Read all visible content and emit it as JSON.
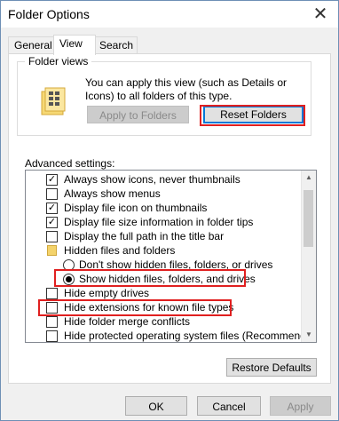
{
  "window": {
    "title": "Folder Options",
    "close_glyph": "✕"
  },
  "tabs": [
    {
      "label": "General",
      "active": false
    },
    {
      "label": "View",
      "active": true
    },
    {
      "label": "Search",
      "active": false
    }
  ],
  "folder_views": {
    "legend": "Folder views",
    "description": "You can apply this view (such as Details or Icons) to all folders of this type.",
    "apply_button": "Apply to Folders",
    "reset_button": "Reset Folders",
    "icon": "folder-icon"
  },
  "advanced": {
    "label": "Advanced settings:",
    "items": [
      {
        "label": "Always show icons, never thumbnails",
        "kind": "checkbox",
        "checked": true
      },
      {
        "label": "Always show menus",
        "kind": "checkbox",
        "checked": false
      },
      {
        "label": "Display file icon on thumbnails",
        "kind": "checkbox",
        "checked": true
      },
      {
        "label": "Display file size information in folder tips",
        "kind": "checkbox",
        "checked": true
      },
      {
        "label": "Display the full path in the title bar",
        "kind": "checkbox",
        "checked": false
      },
      {
        "label": "Hidden files and folders",
        "kind": "folder"
      },
      {
        "label": "Don't show hidden files, folders, or drives",
        "kind": "radio",
        "checked": false
      },
      {
        "label": "Show hidden files, folders, and drives",
        "kind": "radio",
        "checked": true
      },
      {
        "label": "Hide empty drives",
        "kind": "checkbox",
        "checked": false
      },
      {
        "label": "Hide extensions for known file types",
        "kind": "checkbox",
        "checked": false
      },
      {
        "label": "Hide folder merge conflicts",
        "kind": "checkbox",
        "checked": false
      },
      {
        "label": "Hide protected operating system files (Recommended)",
        "kind": "checkbox",
        "checked": false
      }
    ]
  },
  "restore_button": "Restore Defaults",
  "footer": {
    "ok": "OK",
    "cancel": "Cancel",
    "apply": "Apply"
  },
  "colors": {
    "highlight": "#e02020",
    "accent": "#0078d7"
  }
}
